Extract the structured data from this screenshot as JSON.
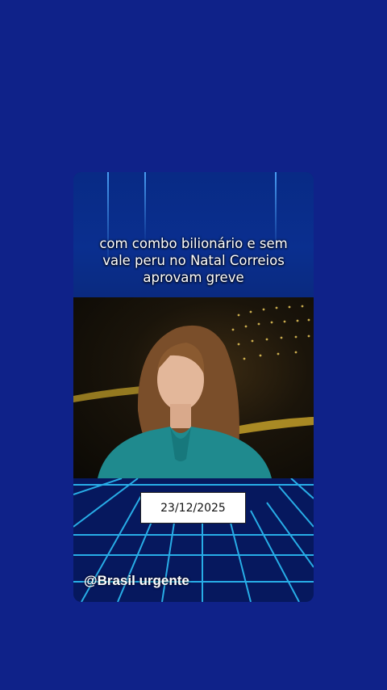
{
  "video_card": {
    "caption": "com combo bilionário e sem\nvale peru no Natal Correios\naprovam greve",
    "date": "23/12/2025",
    "channel_handle": "@Brasil urgente"
  },
  "colors": {
    "page_background": "#0f2289",
    "caption_text": "#ffffff",
    "grid_glow": "#2ec8ff"
  }
}
